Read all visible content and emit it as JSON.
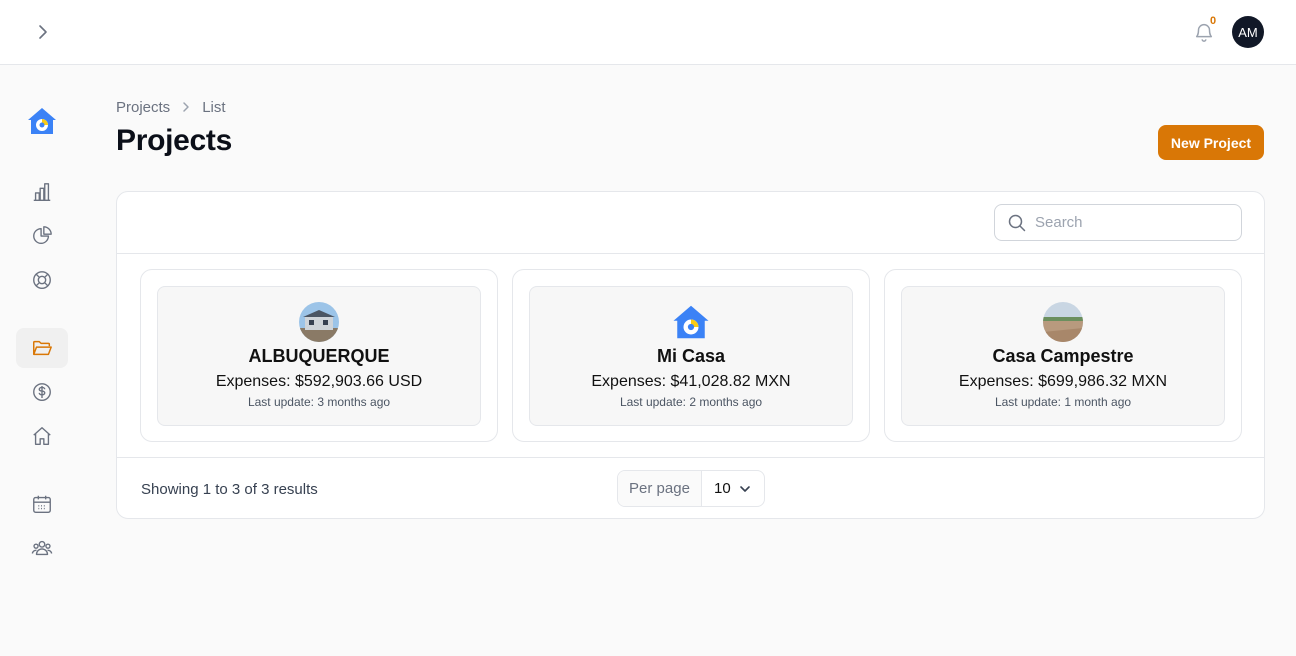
{
  "topbar": {
    "notifications_count": "0",
    "avatar_initials": "AM"
  },
  "breadcrumb": {
    "items": [
      "Projects",
      "List"
    ]
  },
  "page": {
    "title": "Projects",
    "new_button": "New Project"
  },
  "search": {
    "placeholder": "Search"
  },
  "projects": [
    {
      "name": "ALBUQUERQUE",
      "expenses": "Expenses: $592,903.66 USD",
      "last_update": "Last update: 3 months ago"
    },
    {
      "name": "Mi Casa",
      "expenses": "Expenses: $41,028.82 MXN",
      "last_update": "Last update: 2 months ago"
    },
    {
      "name": "Casa Campestre",
      "expenses": "Expenses: $699,986.32 MXN",
      "last_update": "Last update: 1 month ago"
    }
  ],
  "footer": {
    "results_text": "Showing 1 to 3 of 3 results",
    "per_page_label": "Per page",
    "per_page_value": "10"
  },
  "colors": {
    "accent": "#d97706",
    "avatar_bg": "#111827",
    "logo_blue": "#3b82f6",
    "logo_yellow": "#facc15"
  }
}
